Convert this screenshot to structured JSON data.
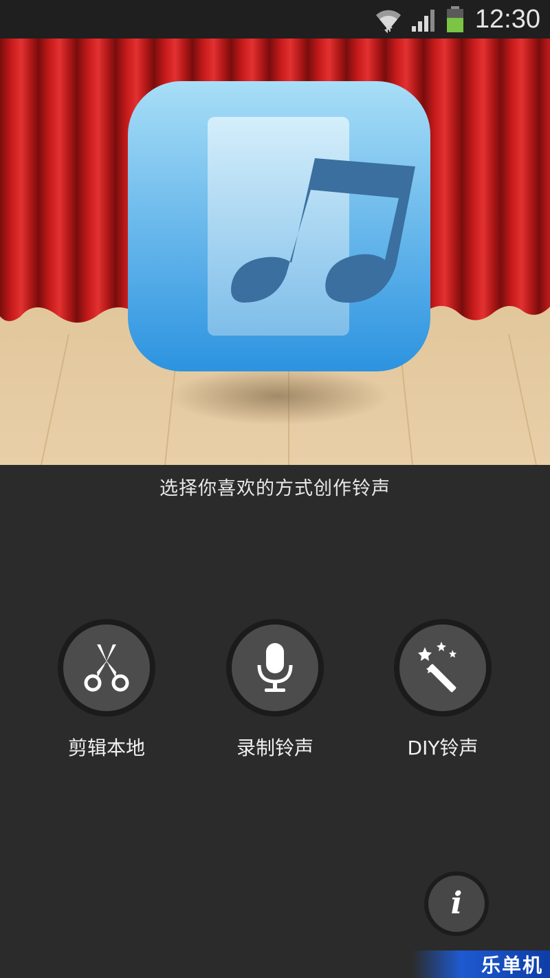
{
  "status_bar": {
    "time": "12:30",
    "icons": [
      "wifi-icon",
      "signal-icon",
      "battery-icon"
    ],
    "battery_color": "#7cc443"
  },
  "hero": {
    "app_icon": "music-note-icon",
    "colors": {
      "curtain": "#c41a1a",
      "floor": "#e2c49a",
      "icon_top": "#a8def7",
      "icon_bottom": "#2c93e0"
    }
  },
  "prompt": "选择你喜欢的方式创作铃声",
  "actions": [
    {
      "label": "剪辑本地",
      "icon": "scissors-icon"
    },
    {
      "label": "录制铃声",
      "icon": "microphone-icon"
    },
    {
      "label": "DIY铃声",
      "icon": "magic-wand-icon"
    }
  ],
  "info_button": {
    "glyph": "i",
    "icon": "info-icon"
  },
  "watermark": "乐单机"
}
